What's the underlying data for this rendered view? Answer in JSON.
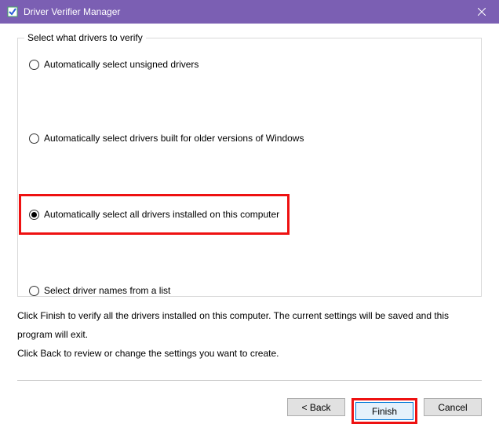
{
  "window": {
    "title": "Driver Verifier Manager"
  },
  "group": {
    "legend": "Select what drivers to verify",
    "options": [
      {
        "label": "Automatically select unsigned drivers",
        "selected": false
      },
      {
        "label": "Automatically select drivers built for older versions of Windows",
        "selected": false
      },
      {
        "label": "Automatically select all drivers installed on this computer",
        "selected": true
      },
      {
        "label": "Select driver names from a list",
        "selected": false
      }
    ]
  },
  "instructions": {
    "line1": "Click Finish to verify all the drivers installed on this computer. The current settings will be saved and this program will exit.",
    "line2": "Click Back to review or change the settings you want to create."
  },
  "buttons": {
    "back": "< Back",
    "finish": "Finish",
    "cancel": "Cancel"
  }
}
